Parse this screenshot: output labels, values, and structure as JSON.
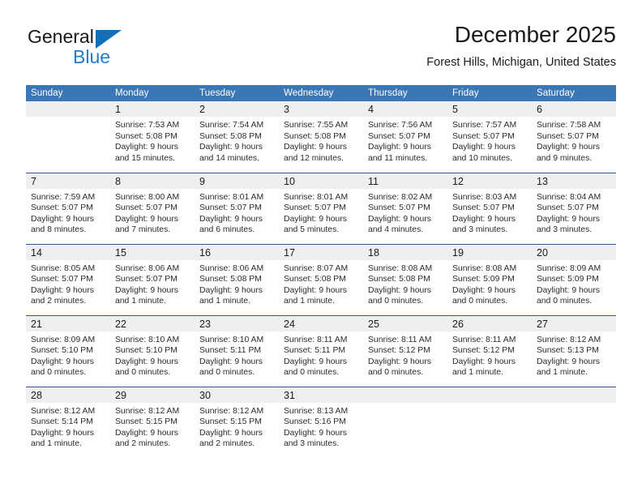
{
  "brand": {
    "name_part1": "General",
    "name_part2": "Blue",
    "accent_color": "#1270bb",
    "logo_icon": "triangle-icon"
  },
  "header": {
    "title": "December 2025",
    "subtitle": "Forest Hills, Michigan, United States"
  },
  "calendar": {
    "header_bg": "#3c77b5",
    "daynum_bg": "#efefef",
    "row_border": "#2a6099",
    "weekday_headers": [
      "Sunday",
      "Monday",
      "Tuesday",
      "Wednesday",
      "Thursday",
      "Friday",
      "Saturday"
    ],
    "weeks": [
      [
        {
          "day": ""
        },
        {
          "day": "1",
          "sunrise": "Sunrise: 7:53 AM",
          "sunset": "Sunset: 5:08 PM",
          "daylight1": "Daylight: 9 hours",
          "daylight2": "and 15 minutes."
        },
        {
          "day": "2",
          "sunrise": "Sunrise: 7:54 AM",
          "sunset": "Sunset: 5:08 PM",
          "daylight1": "Daylight: 9 hours",
          "daylight2": "and 14 minutes."
        },
        {
          "day": "3",
          "sunrise": "Sunrise: 7:55 AM",
          "sunset": "Sunset: 5:08 PM",
          "daylight1": "Daylight: 9 hours",
          "daylight2": "and 12 minutes."
        },
        {
          "day": "4",
          "sunrise": "Sunrise: 7:56 AM",
          "sunset": "Sunset: 5:07 PM",
          "daylight1": "Daylight: 9 hours",
          "daylight2": "and 11 minutes."
        },
        {
          "day": "5",
          "sunrise": "Sunrise: 7:57 AM",
          "sunset": "Sunset: 5:07 PM",
          "daylight1": "Daylight: 9 hours",
          "daylight2": "and 10 minutes."
        },
        {
          "day": "6",
          "sunrise": "Sunrise: 7:58 AM",
          "sunset": "Sunset: 5:07 PM",
          "daylight1": "Daylight: 9 hours",
          "daylight2": "and 9 minutes."
        }
      ],
      [
        {
          "day": "7",
          "sunrise": "Sunrise: 7:59 AM",
          "sunset": "Sunset: 5:07 PM",
          "daylight1": "Daylight: 9 hours",
          "daylight2": "and 8 minutes."
        },
        {
          "day": "8",
          "sunrise": "Sunrise: 8:00 AM",
          "sunset": "Sunset: 5:07 PM",
          "daylight1": "Daylight: 9 hours",
          "daylight2": "and 7 minutes."
        },
        {
          "day": "9",
          "sunrise": "Sunrise: 8:01 AM",
          "sunset": "Sunset: 5:07 PM",
          "daylight1": "Daylight: 9 hours",
          "daylight2": "and 6 minutes."
        },
        {
          "day": "10",
          "sunrise": "Sunrise: 8:01 AM",
          "sunset": "Sunset: 5:07 PM",
          "daylight1": "Daylight: 9 hours",
          "daylight2": "and 5 minutes."
        },
        {
          "day": "11",
          "sunrise": "Sunrise: 8:02 AM",
          "sunset": "Sunset: 5:07 PM",
          "daylight1": "Daylight: 9 hours",
          "daylight2": "and 4 minutes."
        },
        {
          "day": "12",
          "sunrise": "Sunrise: 8:03 AM",
          "sunset": "Sunset: 5:07 PM",
          "daylight1": "Daylight: 9 hours",
          "daylight2": "and 3 minutes."
        },
        {
          "day": "13",
          "sunrise": "Sunrise: 8:04 AM",
          "sunset": "Sunset: 5:07 PM",
          "daylight1": "Daylight: 9 hours",
          "daylight2": "and 3 minutes."
        }
      ],
      [
        {
          "day": "14",
          "sunrise": "Sunrise: 8:05 AM",
          "sunset": "Sunset: 5:07 PM",
          "daylight1": "Daylight: 9 hours",
          "daylight2": "and 2 minutes."
        },
        {
          "day": "15",
          "sunrise": "Sunrise: 8:06 AM",
          "sunset": "Sunset: 5:07 PM",
          "daylight1": "Daylight: 9 hours",
          "daylight2": "and 1 minute."
        },
        {
          "day": "16",
          "sunrise": "Sunrise: 8:06 AM",
          "sunset": "Sunset: 5:08 PM",
          "daylight1": "Daylight: 9 hours",
          "daylight2": "and 1 minute."
        },
        {
          "day": "17",
          "sunrise": "Sunrise: 8:07 AM",
          "sunset": "Sunset: 5:08 PM",
          "daylight1": "Daylight: 9 hours",
          "daylight2": "and 1 minute."
        },
        {
          "day": "18",
          "sunrise": "Sunrise: 8:08 AM",
          "sunset": "Sunset: 5:08 PM",
          "daylight1": "Daylight: 9 hours",
          "daylight2": "and 0 minutes."
        },
        {
          "day": "19",
          "sunrise": "Sunrise: 8:08 AM",
          "sunset": "Sunset: 5:09 PM",
          "daylight1": "Daylight: 9 hours",
          "daylight2": "and 0 minutes."
        },
        {
          "day": "20",
          "sunrise": "Sunrise: 8:09 AM",
          "sunset": "Sunset: 5:09 PM",
          "daylight1": "Daylight: 9 hours",
          "daylight2": "and 0 minutes."
        }
      ],
      [
        {
          "day": "21",
          "sunrise": "Sunrise: 8:09 AM",
          "sunset": "Sunset: 5:10 PM",
          "daylight1": "Daylight: 9 hours",
          "daylight2": "and 0 minutes."
        },
        {
          "day": "22",
          "sunrise": "Sunrise: 8:10 AM",
          "sunset": "Sunset: 5:10 PM",
          "daylight1": "Daylight: 9 hours",
          "daylight2": "and 0 minutes."
        },
        {
          "day": "23",
          "sunrise": "Sunrise: 8:10 AM",
          "sunset": "Sunset: 5:11 PM",
          "daylight1": "Daylight: 9 hours",
          "daylight2": "and 0 minutes."
        },
        {
          "day": "24",
          "sunrise": "Sunrise: 8:11 AM",
          "sunset": "Sunset: 5:11 PM",
          "daylight1": "Daylight: 9 hours",
          "daylight2": "and 0 minutes."
        },
        {
          "day": "25",
          "sunrise": "Sunrise: 8:11 AM",
          "sunset": "Sunset: 5:12 PM",
          "daylight1": "Daylight: 9 hours",
          "daylight2": "and 0 minutes."
        },
        {
          "day": "26",
          "sunrise": "Sunrise: 8:11 AM",
          "sunset": "Sunset: 5:12 PM",
          "daylight1": "Daylight: 9 hours",
          "daylight2": "and 1 minute."
        },
        {
          "day": "27",
          "sunrise": "Sunrise: 8:12 AM",
          "sunset": "Sunset: 5:13 PM",
          "daylight1": "Daylight: 9 hours",
          "daylight2": "and 1 minute."
        }
      ],
      [
        {
          "day": "28",
          "sunrise": "Sunrise: 8:12 AM",
          "sunset": "Sunset: 5:14 PM",
          "daylight1": "Daylight: 9 hours",
          "daylight2": "and 1 minute."
        },
        {
          "day": "29",
          "sunrise": "Sunrise: 8:12 AM",
          "sunset": "Sunset: 5:15 PM",
          "daylight1": "Daylight: 9 hours",
          "daylight2": "and 2 minutes."
        },
        {
          "day": "30",
          "sunrise": "Sunrise: 8:12 AM",
          "sunset": "Sunset: 5:15 PM",
          "daylight1": "Daylight: 9 hours",
          "daylight2": "and 2 minutes."
        },
        {
          "day": "31",
          "sunrise": "Sunrise: 8:13 AM",
          "sunset": "Sunset: 5:16 PM",
          "daylight1": "Daylight: 9 hours",
          "daylight2": "and 3 minutes."
        },
        {
          "day": ""
        },
        {
          "day": ""
        },
        {
          "day": ""
        }
      ]
    ]
  }
}
